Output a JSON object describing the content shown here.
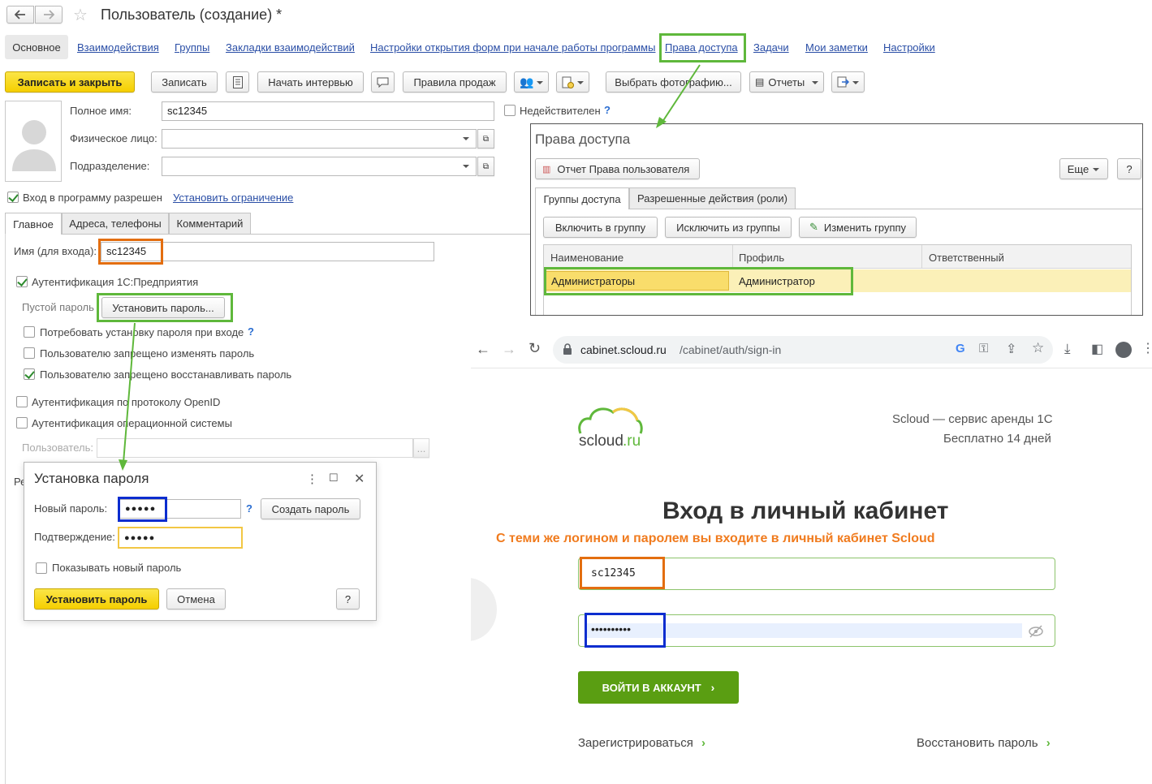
{
  "window": {
    "title": "Пользователь (создание) *"
  },
  "nav_tabs": [
    "Основное",
    "Взаимодействия",
    "Группы",
    "Закладки взаимодействий",
    "Настройки открытия форм при начале работы программы",
    "Права доступа",
    "Задачи",
    "Мои заметки",
    "Настройки"
  ],
  "toolbar": {
    "save_close": "Записать и закрыть",
    "save": "Записать",
    "start_interview": "Начать интервью",
    "sales_rules": "Правила продаж",
    "choose_photo": "Выбрать фотографию...",
    "reports": "Отчеты"
  },
  "form": {
    "full_name_label": "Полное имя:",
    "full_name_value": "sc12345",
    "person_label": "Физическое лицо:",
    "dept_label": "Подразделение:",
    "invalid_label": "Недействителен",
    "help": "?",
    "login_allowed": "Вход в программу разрешен",
    "set_restriction": "Установить ограничение",
    "inner_tabs": [
      "Главное",
      "Адреса, телефоны",
      "Комментарий"
    ],
    "login_name_label": "Имя (для входа):",
    "login_name_value": "sc12345",
    "auth_1c": "Аутентификация 1С:Предприятия",
    "empty_password": "Пустой пароль",
    "set_password_btn": "Установить пароль...",
    "require_change": "Потребовать установку пароля при входе",
    "deny_change": "Пользователю запрещено изменять пароль",
    "deny_restore": "Пользователю запрещено восстанавливать пароль",
    "auth_openid": "Аутентификация по протоколу OpenID",
    "auth_os": "Аутентификация операционной системы",
    "user_label": "Пользователь:",
    "ellipsis": "...",
    "partial_label": "Ре"
  },
  "password_dialog": {
    "title": "Установка пароля",
    "new_label": "Новый пароль:",
    "new_value": "●●●●●",
    "help": "?",
    "create_btn": "Создать пароль",
    "confirm_label": "Подтверждение:",
    "confirm_value": "●●●●●",
    "show_label": "Показывать новый пароль",
    "set_btn": "Установить пароль",
    "cancel_btn": "Отмена",
    "help_btn": "?"
  },
  "access_panel": {
    "title": "Права доступа",
    "report_btn": "Отчет Права пользователя",
    "more_btn": "Еще",
    "help_btn": "?",
    "tabs": [
      "Группы доступа",
      "Разрешенные действия (роли)"
    ],
    "include_btn": "Включить в группу",
    "exclude_btn": "Исключить из группы",
    "edit_btn": "Изменить группу",
    "columns": [
      "Наименование",
      "Профиль",
      "Ответственный"
    ],
    "rows": [
      [
        "Администраторы",
        "Администратор",
        ""
      ]
    ]
  },
  "browser": {
    "url_host": "cabinet.scloud.ru",
    "url_path": "/cabinet/auth/sign-in",
    "logo_text": "scloud",
    "logo_suffix": ".ru",
    "tagline1": "Scloud — сервис аренды 1С",
    "tagline2": "Бесплатно 14 дней",
    "heading": "Вход в личный кабинет",
    "note": "С теми же логином и паролем вы входите в личный кабинет Scloud",
    "login_value": "sc12345",
    "password_value": "••••••••••",
    "submit": "ВОЙТИ В АККАУНТ",
    "register": "Зарегистрироваться",
    "restore": "Восстановить пароль"
  },
  "colors": {
    "accent_green": "#5fb83b",
    "orange": "#e36e10",
    "blue": "#0c2dcf",
    "button_yellow": "#f5cf00",
    "login_button": "#5a9e12"
  }
}
